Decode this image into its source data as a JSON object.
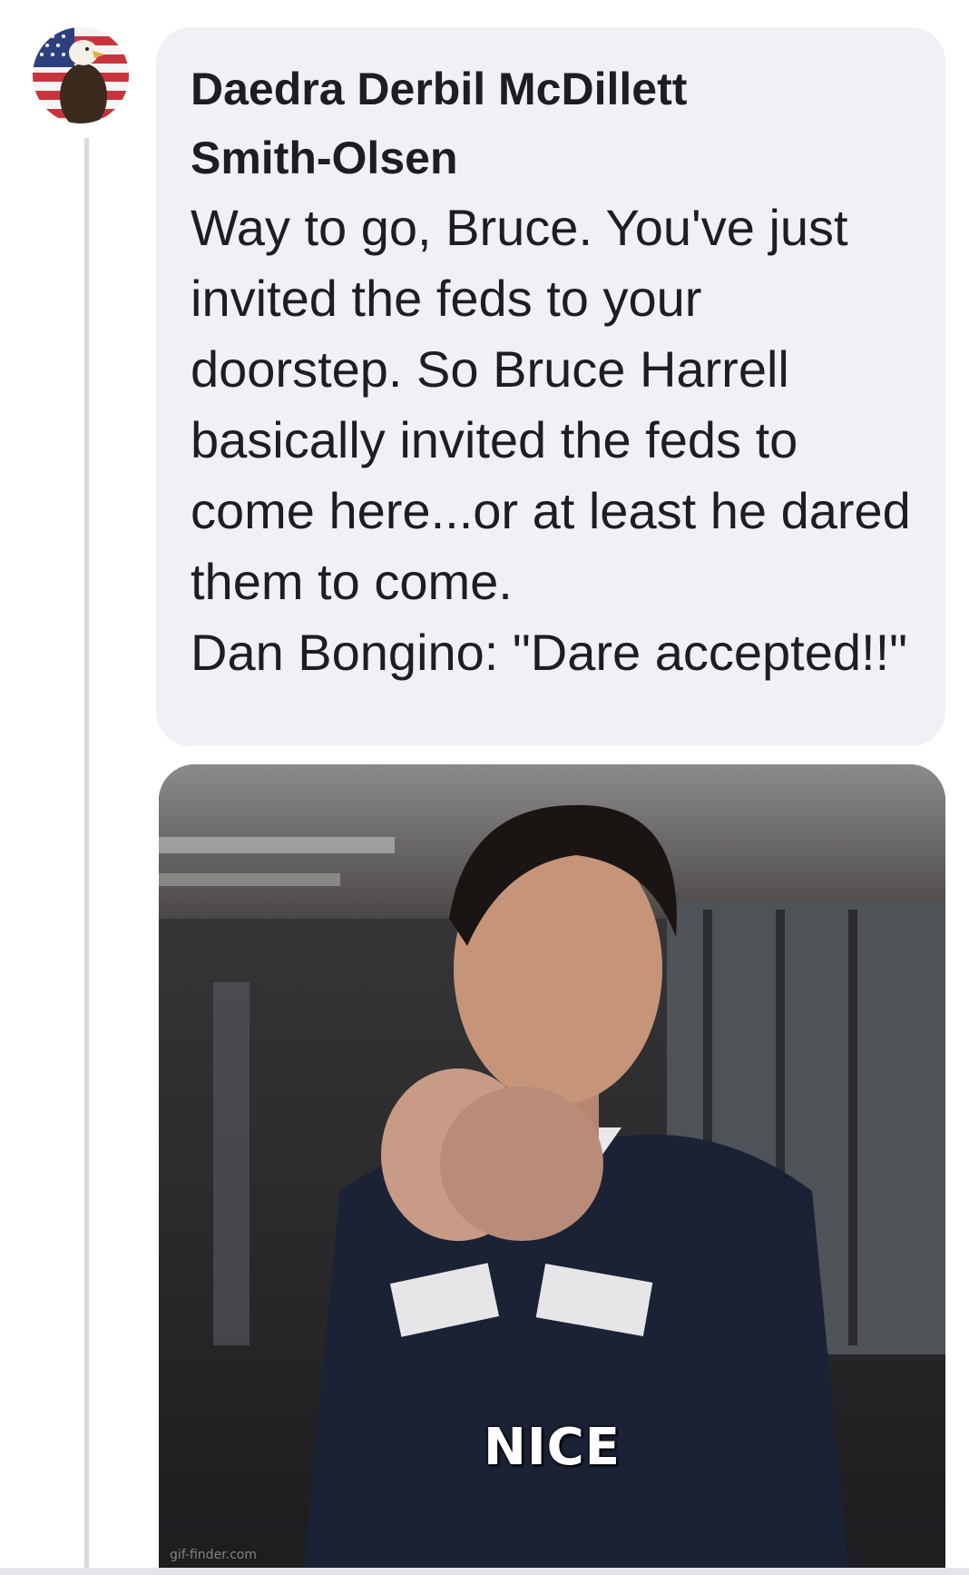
{
  "comment": {
    "author": "Daedra Derbil McDillett Smith-Olsen",
    "text_paragraphs": [
      "Way to go, Bruce. You've just invited the feds to your doorstep. So Bruce Harrell basically invited the feds to come here...or at least he dared them to come.",
      "Dan Bongino: \"Dare accepted!!\""
    ],
    "avatar_icon": "eagle-flag-avatar"
  },
  "attachment": {
    "type": "gif",
    "caption": "NICE",
    "watermark": "gif-finder.com"
  },
  "colors": {
    "bubble_bg": "#f0f1f4",
    "text": "#1c1e21",
    "thread_line": "#d9dadf"
  }
}
